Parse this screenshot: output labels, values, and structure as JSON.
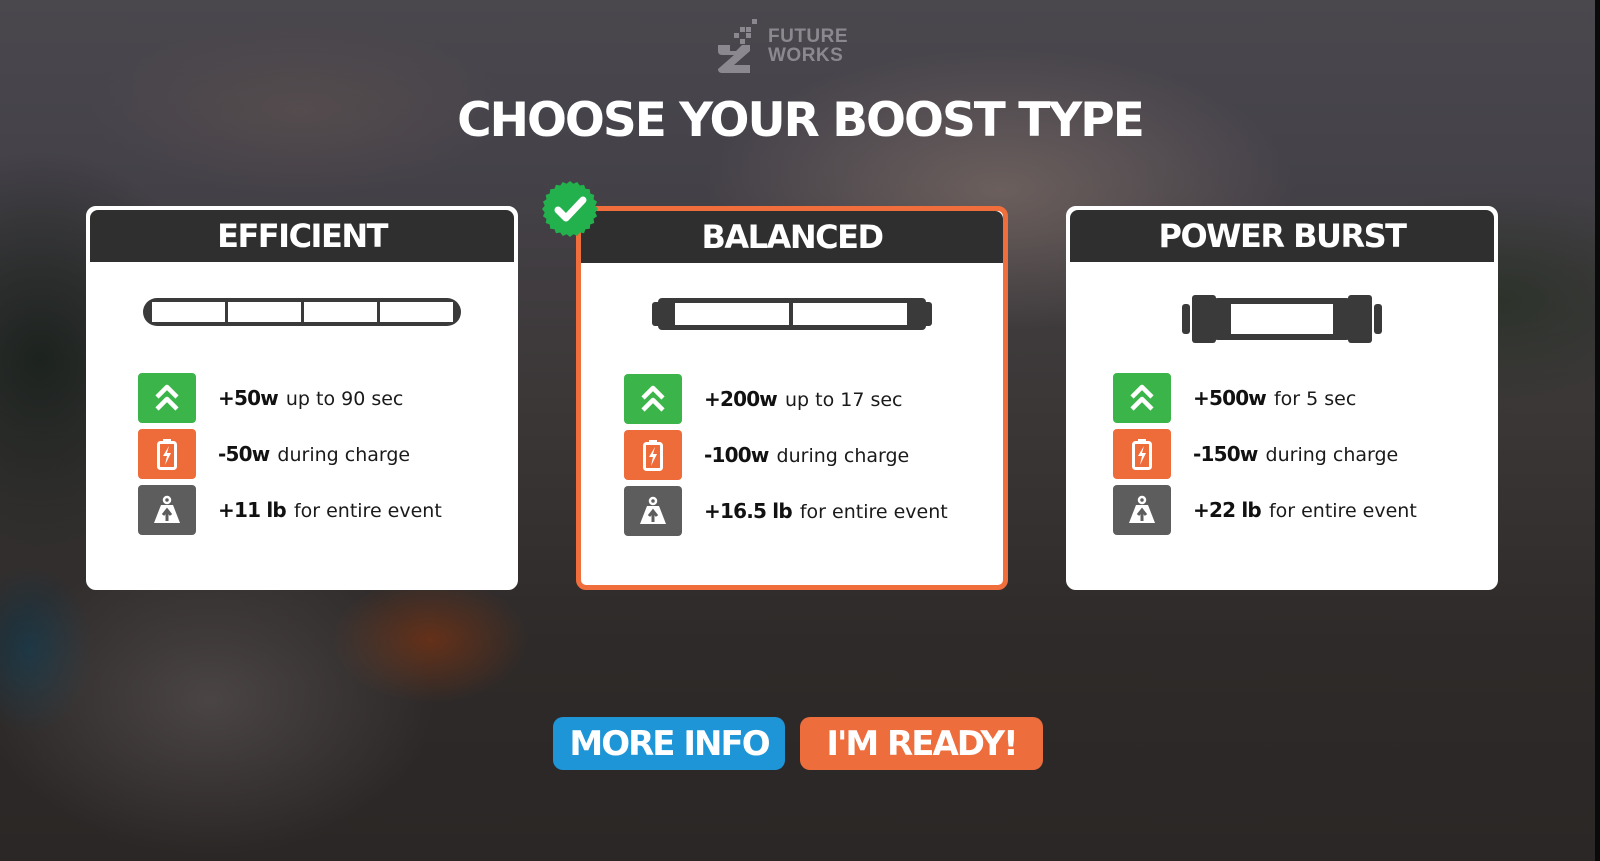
{
  "logo": {
    "line1": "FUTURE",
    "line2": "WORKS",
    "icon": "future-works-logo-icon"
  },
  "title": "CHOOSE YOUR BOOST TYPE",
  "colors": {
    "card_header": "#2f2f2f",
    "selected_border": "#ef6e3c",
    "boost_icon_bg": "#3bb54a",
    "charge_icon_bg": "#ee6b3a",
    "weight_icon_bg": "#5d5d5d",
    "more_info_button": "#1d95d6",
    "ready_button": "#ee6d3c",
    "selected_badge": "#22b14c"
  },
  "cards": [
    {
      "name": "EFFICIENT",
      "selected": false,
      "battery_segments": 4,
      "stats": [
        {
          "icon": "double-chevron-up-icon",
          "value": "+50w",
          "desc": "up to 90 sec"
        },
        {
          "icon": "battery-charge-icon",
          "value": "-50w",
          "desc": "during charge"
        },
        {
          "icon": "weight-icon",
          "value": "+11 lb",
          "desc": "for entire event"
        }
      ]
    },
    {
      "name": "BALANCED",
      "selected": true,
      "battery_segments": 2,
      "stats": [
        {
          "icon": "double-chevron-up-icon",
          "value": "+200w",
          "desc": "up to 17 sec"
        },
        {
          "icon": "battery-charge-icon",
          "value": "-100w",
          "desc": "during charge"
        },
        {
          "icon": "weight-icon",
          "value": "+16.5 lb",
          "desc": "for entire event"
        }
      ]
    },
    {
      "name": "POWER BURST",
      "selected": false,
      "battery_segments": 1,
      "stats": [
        {
          "icon": "double-chevron-up-icon",
          "value": "+500w",
          "desc": "for 5 sec"
        },
        {
          "icon": "battery-charge-icon",
          "value": "-150w",
          "desc": "during charge"
        },
        {
          "icon": "weight-icon",
          "value": "+22 lb",
          "desc": "for entire event"
        }
      ]
    }
  ],
  "buttons": {
    "more_info": "MORE INFO",
    "ready": "I'M READY!"
  }
}
